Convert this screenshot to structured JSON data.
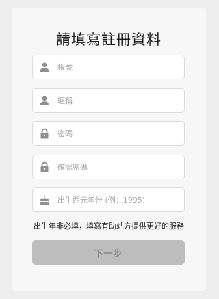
{
  "form": {
    "title": "請填寫註冊資料",
    "fields": [
      {
        "icon": "person-icon",
        "placeholder": "帳號",
        "value": ""
      },
      {
        "icon": "person-icon",
        "placeholder": "暱稱",
        "value": ""
      },
      {
        "icon": "lock-icon",
        "placeholder": "密碼",
        "value": ""
      },
      {
        "icon": "lock-icon",
        "placeholder": "確認密碼",
        "value": ""
      },
      {
        "icon": "cake-icon",
        "placeholder": "出生西元年份 (例：1995)",
        "value": ""
      }
    ],
    "note": "出生年非必填，填寫有助站方提供更好的服務",
    "next_label": "下一步"
  },
  "colors": {
    "icon": "#8f8f8f",
    "button_disabled_bg": "#bdbdbd",
    "button_disabled_text": "#8a8a8a",
    "card_bg": "#f7f7f7",
    "page_bg": "#eeeeee"
  }
}
